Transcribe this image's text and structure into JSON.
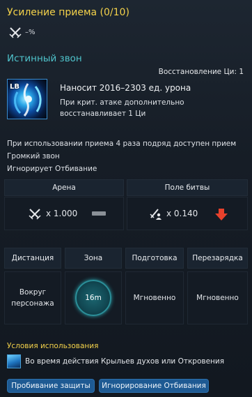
{
  "header": {
    "title": "Усиление приема (0/10)",
    "enhancement_value": "–%",
    "enhancement_icon": "crossed-swords-icon"
  },
  "skill": {
    "name": "Истинный звон",
    "recovery": "Восстановление Ци: 1",
    "icon_key": "LB",
    "damage": "Наносит 2016–2303 ед. урона",
    "crit_line1": "При крит. атаке дополнительно",
    "crit_line2": "восстанавливает 1 Ци"
  },
  "description": {
    "line1": "При использовании приема 4 раза подряд доступен прием",
    "line2": "Громкий звон",
    "line3": "Игнорирует Отбивание"
  },
  "modes": {
    "arena_label": "Арена",
    "battlefield_label": "Поле битвы",
    "arena_value": "x 1.000",
    "battlefield_value": "x 0.140",
    "arena_change": "neutral",
    "battlefield_change": "decrease",
    "colors": {
      "decrease": "#e8412c",
      "neutral": "#8a9097"
    }
  },
  "stats": {
    "headers": [
      "Дистанция",
      "Зона",
      "Подготовка",
      "Перезарядка"
    ],
    "distance": "Вокруг персонажа",
    "zone": "16m",
    "cast": "Мгновенно",
    "cooldown": "Мгновенно"
  },
  "conditions": {
    "title": "Условия использования",
    "text": "Во время действия Крыльев духов или Откровения",
    "icon": "wings-icon"
  },
  "tags": [
    "Пробивание защиты",
    "Игнорирование Отбивания"
  ],
  "colors": {
    "title": "#f4d24a",
    "skill_name": "#4fc3cb",
    "tag_bg": "#1e5a93"
  }
}
